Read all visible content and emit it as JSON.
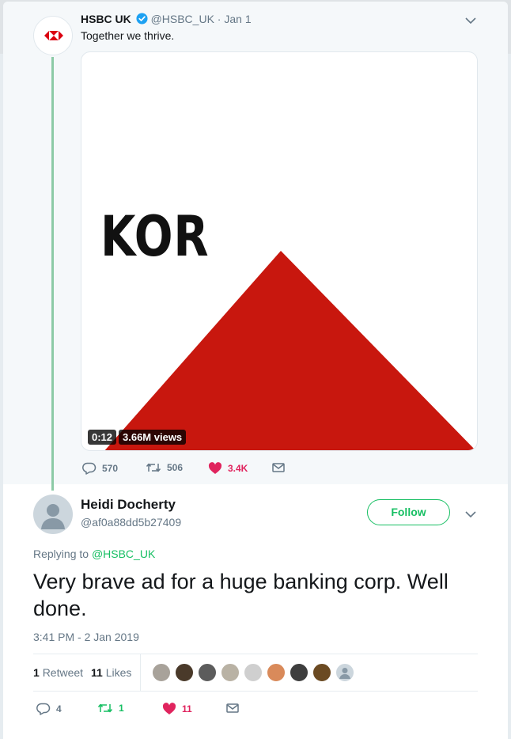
{
  "parent_tweet": {
    "author_name": "HSBC UK",
    "author_handle": "@HSBC_UK",
    "separator": "·",
    "date": "Jan 1",
    "text": "Together we thrive.",
    "media": {
      "title_text": "KOR",
      "duration": "0:12",
      "views": "3.66M views",
      "triangle_color": "#c8170e"
    },
    "actions": {
      "replies": "570",
      "retweets": "506",
      "likes": "3.4K"
    }
  },
  "reply_tweet": {
    "author_name": "Heidi Docherty",
    "author_handle": "@af0a88dd5b27409",
    "follow_label": "Follow",
    "replying_prefix": "Replying to",
    "replying_to": "@HSBC_UK",
    "text": "Very brave ad for a huge banking corp. Well done.",
    "timestamp": "3:41 PM - 2 Jan 2019",
    "stats": {
      "retweets_count": "1",
      "retweets_label": "Retweet",
      "likes_count": "11",
      "likes_label": "Likes"
    },
    "liker_avatar_count": 9,
    "actions": {
      "replies": "4",
      "retweets": "1",
      "likes": "11"
    }
  },
  "colors": {
    "accent_green": "#17bf63",
    "like_pink": "#e0245e",
    "verified_blue": "#1da1f2",
    "hsbc_red": "#db0011"
  },
  "icons": [
    "hsbc-logo-icon",
    "verified-badge-icon",
    "chevron-down-icon",
    "reply-icon",
    "retweet-icon",
    "heart-icon",
    "direct-message-icon",
    "default-avatar-icon"
  ]
}
